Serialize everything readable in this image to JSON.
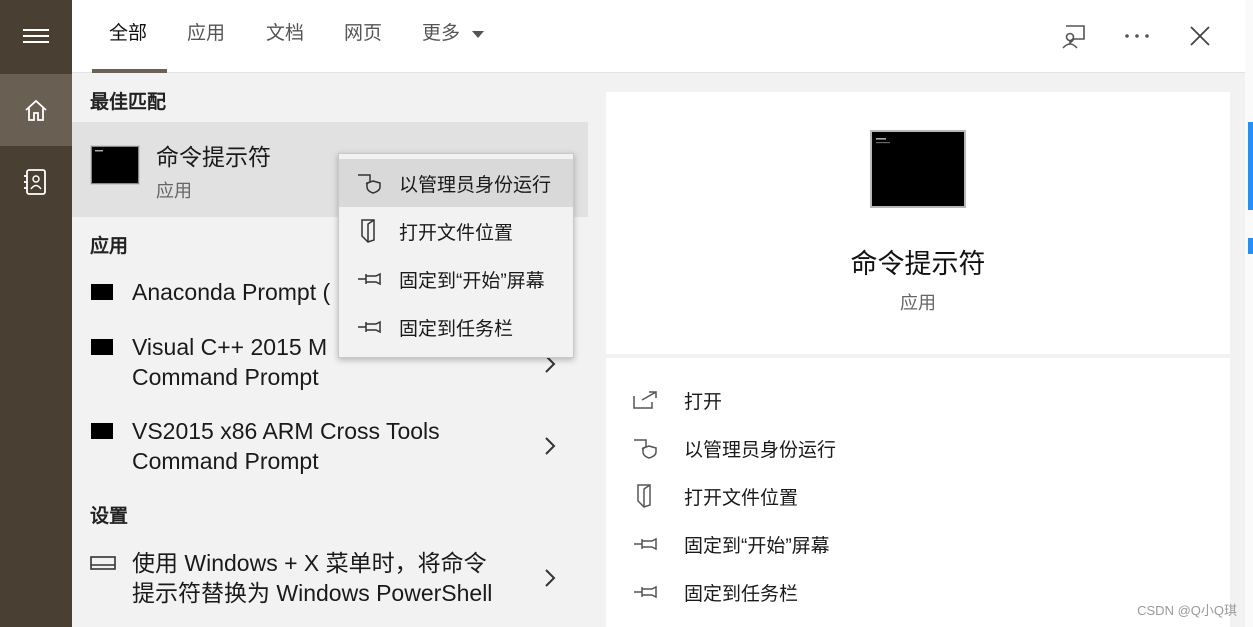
{
  "rail": {
    "items": [
      {
        "icon": "hamburger-menu-icon"
      },
      {
        "icon": "home-icon"
      },
      {
        "icon": "notebook-icon"
      }
    ]
  },
  "tabs": [
    {
      "label": "全部",
      "active": true
    },
    {
      "label": "应用"
    },
    {
      "label": "文档"
    },
    {
      "label": "网页"
    },
    {
      "label": "更多"
    }
  ],
  "top_icons": [
    "feedback-icon",
    "more-options-icon",
    "close-icon"
  ],
  "sections": {
    "best_match": "最佳匹配",
    "apps": "应用",
    "settings": "设置"
  },
  "best_match": {
    "title": "命令提示符",
    "subtitle": "应用"
  },
  "apps": [
    {
      "line1": "Anaconda Prompt (",
      "line2": ""
    },
    {
      "line1": "Visual C++ 2015 M",
      "line2": "Command Prompt"
    },
    {
      "line1": "VS2015 x86 ARM Cross Tools",
      "line2": "Command Prompt"
    }
  ],
  "settings_items": [
    {
      "line1": "使用 Windows + X 菜单时，将命令",
      "line2": "提示符替换为 Windows PowerShell"
    }
  ],
  "context_menu": [
    {
      "label": "以管理员身份运行",
      "icon": "shield-icon",
      "highlighted": true
    },
    {
      "label": "打开文件位置",
      "icon": "file-location-icon"
    },
    {
      "label": "固定到“开始”屏幕",
      "icon": "pin-icon"
    },
    {
      "label": "固定到任务栏",
      "icon": "pin-icon"
    }
  ],
  "preview": {
    "title": "命令提示符",
    "subtitle": "应用"
  },
  "actions": [
    {
      "label": "打开",
      "icon": "open-icon"
    },
    {
      "label": "以管理员身份运行",
      "icon": "shield-icon"
    },
    {
      "label": "打开文件位置",
      "icon": "file-location-icon"
    },
    {
      "label": "固定到“开始”屏幕",
      "icon": "pin-icon"
    },
    {
      "label": "固定到任务栏",
      "icon": "pin-icon"
    }
  ],
  "watermark": "CSDN @Q小Q琪",
  "colors": {
    "rail": "#4a3f33",
    "rail_active": "#6a5f53",
    "accent_underline": "#6b6156",
    "highlight": "#e1e1e1"
  }
}
